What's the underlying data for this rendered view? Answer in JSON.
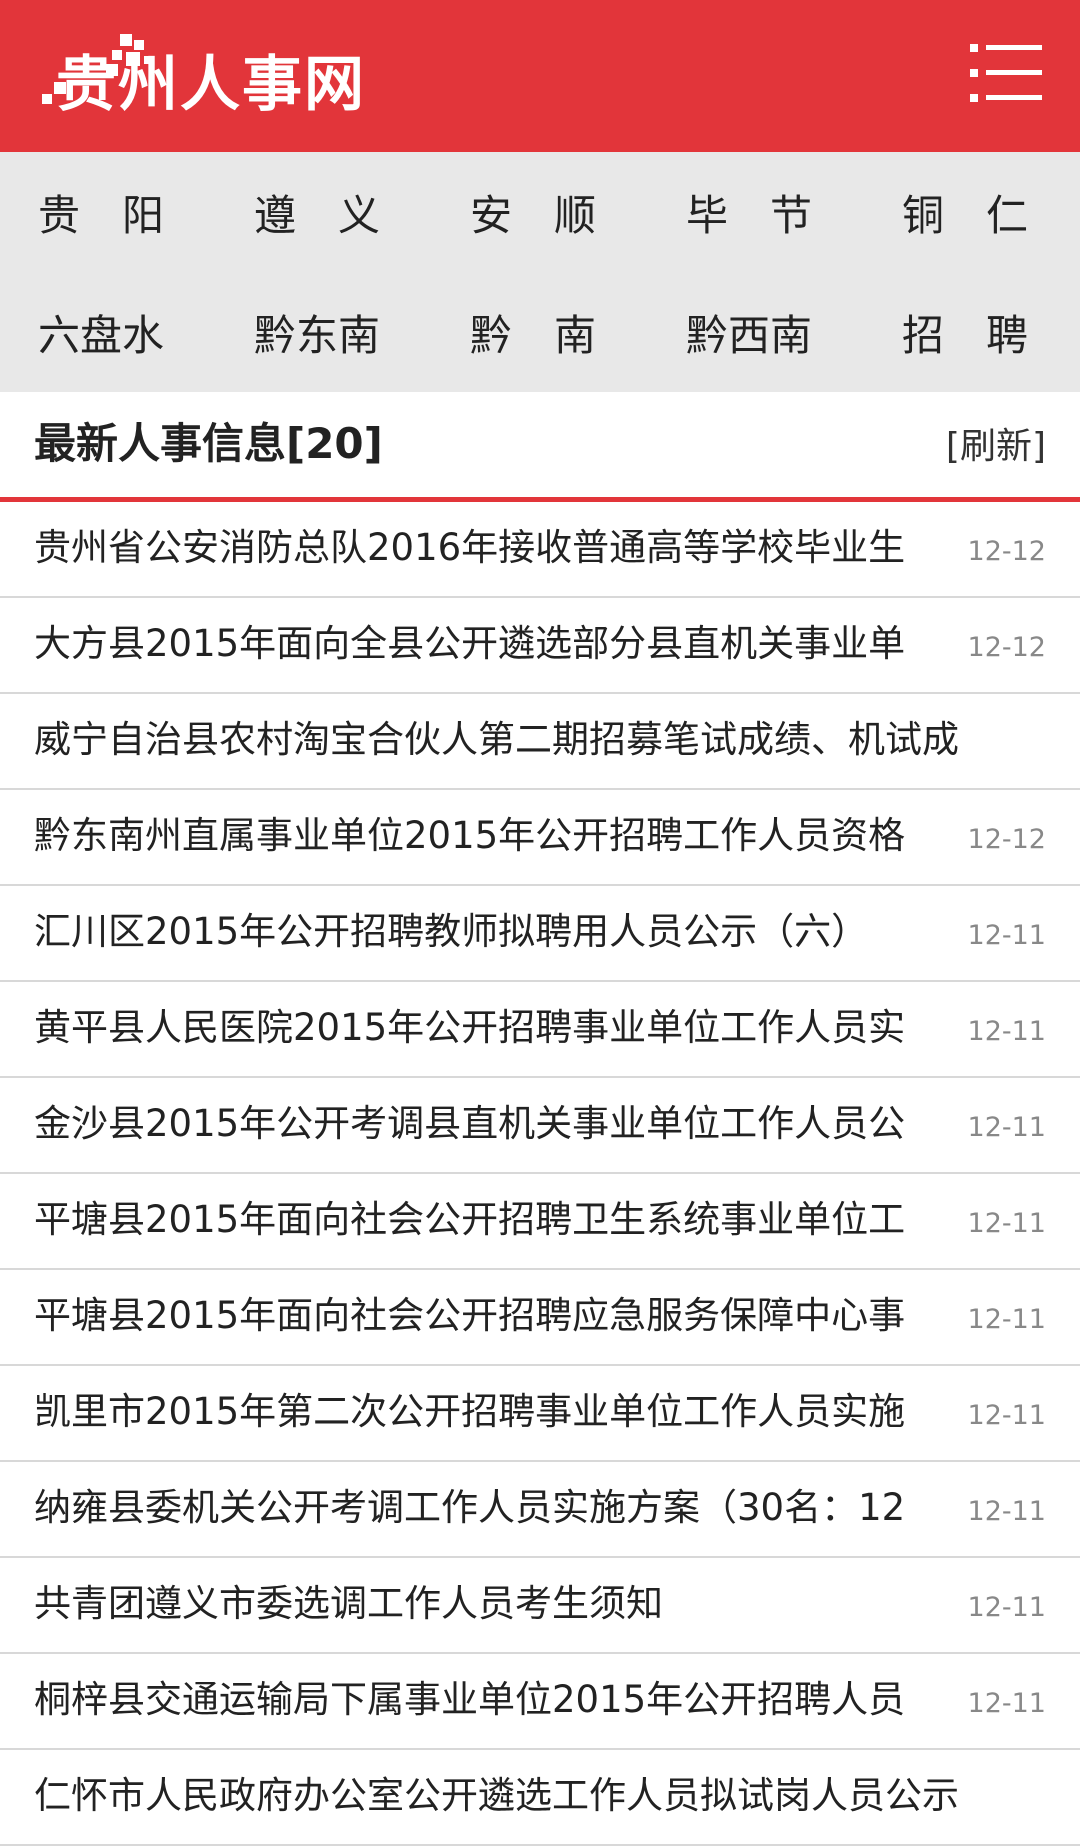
{
  "header": {
    "logo_text": "贵州人事网",
    "menu_icon": "hamburger-menu-icon",
    "background_color": "#e2353a"
  },
  "nav": {
    "row1": [
      "贵　阳",
      "遵　义",
      "安　顺",
      "毕　节",
      "铜　仁"
    ],
    "row2": [
      "六盘水",
      "黔东南",
      "黔　南",
      "黔西南",
      "招　聘"
    ]
  },
  "section": {
    "title": "最新人事信息[20]",
    "refresh_label": "[刷新]"
  },
  "news": [
    {
      "title": "贵州省公安消防总队2016年接收普通高等学校毕业生",
      "date": "12-12"
    },
    {
      "title": "大方县2015年面向全县公开遴选部分县直机关事业单",
      "date": "12-12"
    },
    {
      "title": "威宁自治县农村淘宝合伙人第二期招募笔试成绩、机试成",
      "date": ""
    },
    {
      "title": "黔东南州直属事业单位2015年公开招聘工作人员资格",
      "date": "12-12"
    },
    {
      "title": "汇川区2015年公开招聘教师拟聘用人员公示（六）",
      "date": "12-11"
    },
    {
      "title": "黄平县人民医院2015年公开招聘事业单位工作人员实",
      "date": "12-11"
    },
    {
      "title": "金沙县2015年公开考调县直机关事业单位工作人员公",
      "date": "12-11"
    },
    {
      "title": "平塘县2015年面向社会公开招聘卫生系统事业单位工",
      "date": "12-11"
    },
    {
      "title": "平塘县2015年面向社会公开招聘应急服务保障中心事",
      "date": "12-11"
    },
    {
      "title": "凯里市2015年第二次公开招聘事业单位工作人员实施",
      "date": "12-11"
    },
    {
      "title": "纳雍县委机关公开考调工作人员实施方案（30名：12",
      "date": "12-11"
    },
    {
      "title": "共青团遵义市委选调工作人员考生须知",
      "date": "12-11"
    },
    {
      "title": "桐梓县交通运输局下属事业单位2015年公开招聘人员",
      "date": "12-11"
    },
    {
      "title": "仁怀市人民政府办公室公开遴选工作人员拟试岗人员公示",
      "date": ""
    }
  ]
}
